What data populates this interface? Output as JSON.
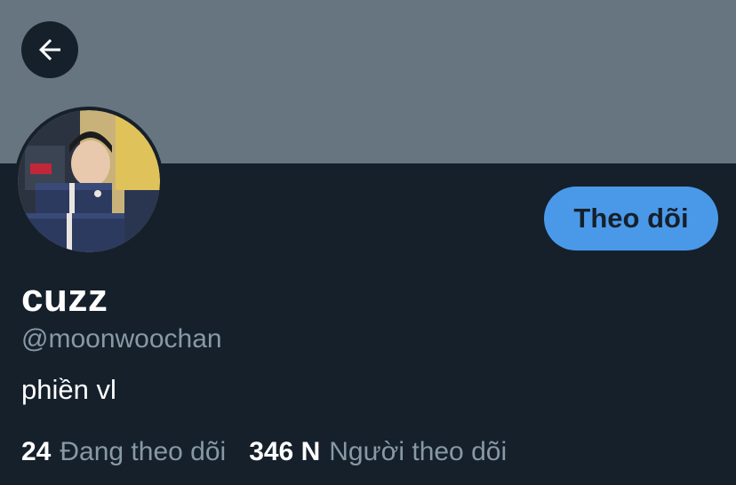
{
  "profile": {
    "display_name": "cuzz",
    "handle": "@moonwoochan",
    "bio": "phiền vl"
  },
  "actions": {
    "follow_label": "Theo dõi"
  },
  "stats": {
    "following_count": "24",
    "following_label": "Đang theo dõi",
    "followers_count": "346 N",
    "followers_label": "Người theo dõi"
  },
  "icons": {
    "back": "arrow-left-icon",
    "avatar": "profile-photo"
  },
  "colors": {
    "background": "#15202b",
    "banner": "#66757f",
    "accent": "#4a99e9",
    "muted_text": "#8899a6",
    "primary_text": "#ffffff"
  }
}
